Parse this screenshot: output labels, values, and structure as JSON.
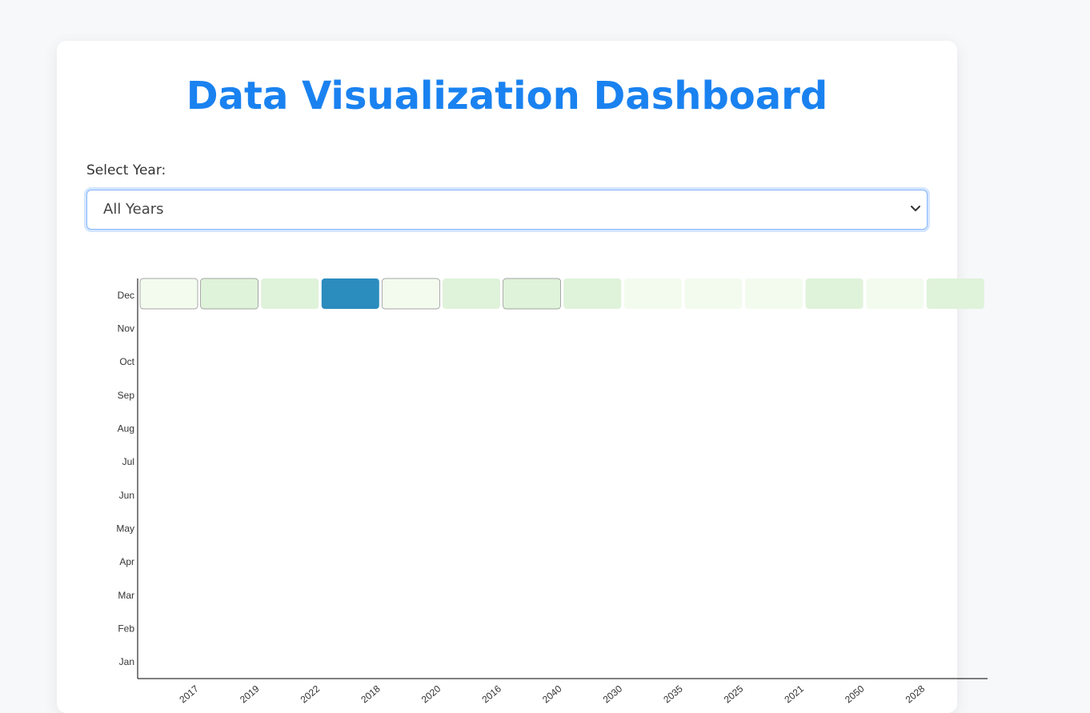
{
  "page": {
    "title": "Data Visualization Dashboard",
    "select_label": "Select Year:",
    "select_value": "All Years"
  },
  "colors": {
    "title": "#1a82f0",
    "scale_low": "#f3fbef",
    "scale_mid": "#dff2da",
    "scale_high": "#2b8cbe"
  },
  "chart_data": {
    "type": "heatmap",
    "x_categories": [
      "2017",
      "2019",
      "2022",
      "2018",
      "2020",
      "2016",
      "2040",
      "2030",
      "2035",
      "2025",
      "2021",
      "2050",
      "2028"
    ],
    "y_categories": [
      "Jan",
      "Feb",
      "Mar",
      "Apr",
      "May",
      "Jun",
      "Jul",
      "Aug",
      "Sep",
      "Oct",
      "Nov",
      "Dec"
    ],
    "cells": [
      {
        "x": "2017",
        "y": "Dec",
        "value": 1
      },
      {
        "x": "2019",
        "y": "Dec",
        "value": 2
      },
      {
        "x": "2022",
        "y": "Dec",
        "value": 2
      },
      {
        "x": "2018",
        "y": "Dec",
        "value": 10
      },
      {
        "x": "2020",
        "y": "Dec",
        "value": 1
      },
      {
        "x": "2016",
        "y": "Dec",
        "value": 2
      },
      {
        "x": "2040",
        "y": "Dec",
        "value": 2
      },
      {
        "x": "2030",
        "y": "Dec",
        "value": 2
      },
      {
        "x": "2035",
        "y": "Dec",
        "value": 1
      },
      {
        "x": "2025",
        "y": "Dec",
        "value": 1
      },
      {
        "x": "2021",
        "y": "Dec",
        "value": 1
      },
      {
        "x": "2050",
        "y": "Dec",
        "value": 2
      },
      {
        "x": "2028",
        "y": "Dec",
        "value": 1
      },
      {
        "x": "",
        "y": "Dec",
        "value": 2
      }
    ],
    "cell_columns": [
      "",
      "2017",
      "2019",
      "2022",
      "2018",
      "2020",
      "2016",
      "2040",
      "2030",
      "2035",
      "2025",
      "2021",
      "2050",
      "2028"
    ],
    "cell_values": [
      1,
      2,
      2,
      10,
      1,
      2,
      2,
      2,
      1,
      1,
      1,
      2,
      1,
      2
    ],
    "cell_outlined": [
      true,
      true,
      false,
      false,
      true,
      false,
      true,
      false,
      false,
      false,
      false,
      false,
      false,
      false
    ],
    "title": "",
    "xlabel": "",
    "ylabel": "",
    "grid": false
  }
}
